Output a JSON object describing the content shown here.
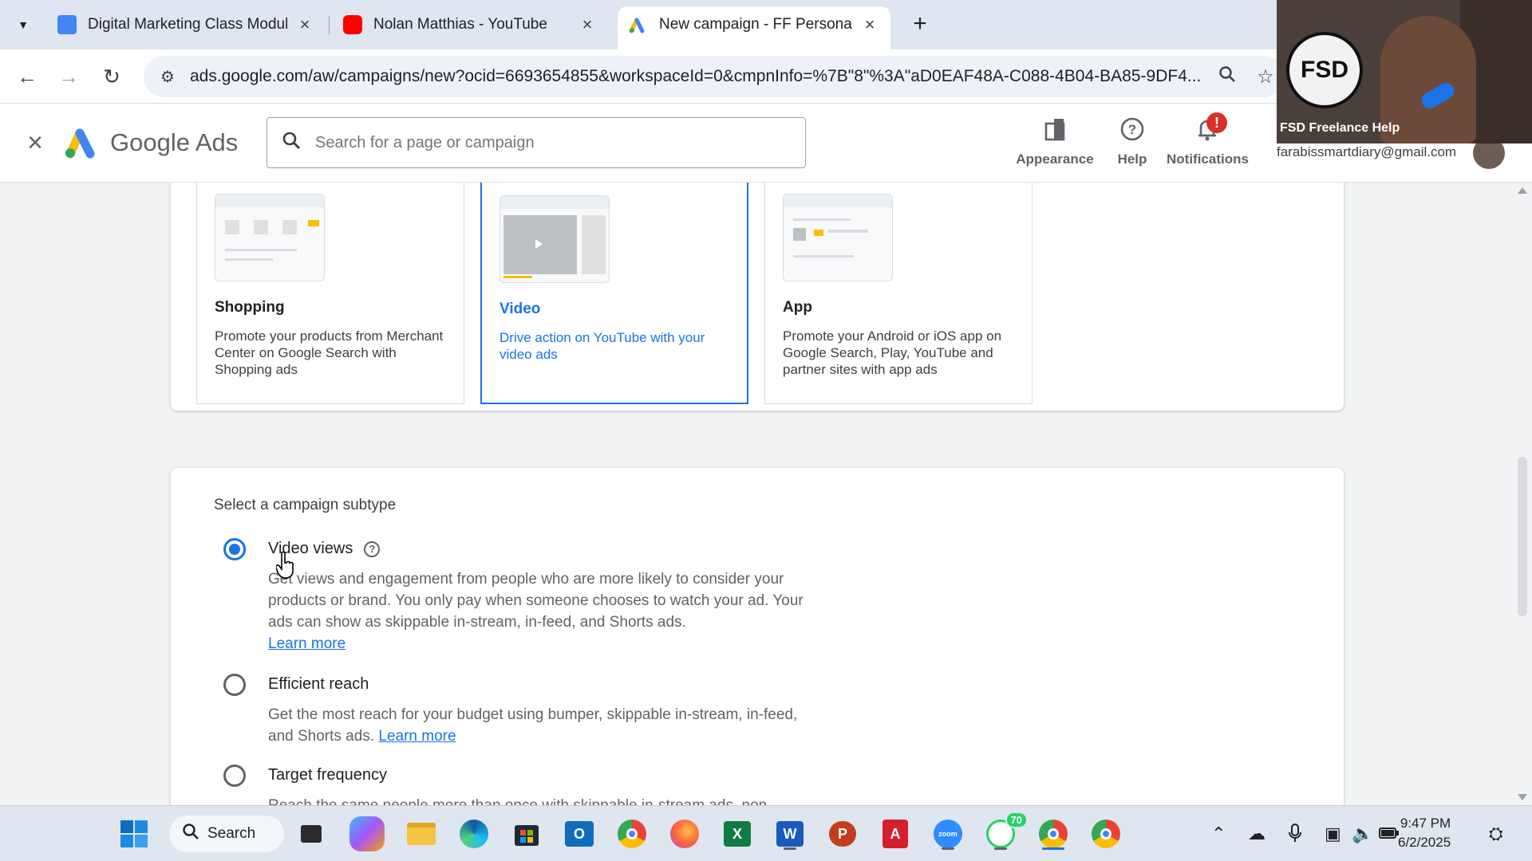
{
  "browser": {
    "tabs": [
      {
        "label": "Digital Marketing Class Module",
        "favicon": "docs-icon",
        "color": "#4285f4"
      },
      {
        "label": "Nolan Matthias - YouTube",
        "favicon": "youtube-icon",
        "color": "#ff0000"
      },
      {
        "label": "New campaign - FF Personal - G",
        "favicon": "google-ads-icon",
        "active": true
      }
    ],
    "url": "ads.google.com/aw/campaigns/new?ocid=6693654855&workspaceId=0&cmpnInfo=%7B\"8\"%3A\"aD0EAF48A-C088-4B04-BA85-9DF4..."
  },
  "ads_header": {
    "product_name": "Google Ads",
    "search_placeholder": "Search for a page or campaign",
    "buttons": [
      {
        "label": "Appearance",
        "icon": "appearance-icon"
      },
      {
        "label": "Help",
        "icon": "help-icon"
      },
      {
        "label": "Notifications",
        "icon": "bell-icon",
        "badge": "!"
      }
    ],
    "account_email": "farabissmartdiary@gmail.com"
  },
  "webcam": {
    "caption": "FSD Freelance Help",
    "logo_text": "FSD"
  },
  "campaign_types": [
    {
      "title": "Shopping",
      "description": "Promote your products from Merchant Center on Google Search with Shopping ads",
      "selected": false
    },
    {
      "title": "Video",
      "description": "Drive action on YouTube with your video ads",
      "selected": true
    },
    {
      "title": "App",
      "description": "Promote your Android or iOS app on Google Search, Play, YouTube and partner sites with app ads",
      "selected": false
    }
  ],
  "subtype": {
    "heading": "Select a campaign subtype",
    "options": [
      {
        "label": "Video views",
        "description": "Get views and engagement from people who are more likely to consider your products or brand. You only pay when someone chooses to watch your ad. Your ads can show as skippable in-stream, in-feed, and Shorts ads.",
        "link": "Learn more",
        "checked": true
      },
      {
        "label": "Efficient reach",
        "description": "Get the most reach for your budget using bumper, skippable in-stream, in-feed, and Shorts ads.",
        "link": "Learn more",
        "checked": false
      },
      {
        "label": "Target frequency",
        "description": "Reach the same people more than once with skippable in-stream ads, non-",
        "checked": false
      }
    ]
  },
  "taskbar": {
    "search_label": "Search",
    "whatsapp_badge": "70",
    "time": "9:47 PM",
    "date": "6/2/2025"
  },
  "colors": {
    "accent": "#1a73e8",
    "notification": "#d93025"
  }
}
